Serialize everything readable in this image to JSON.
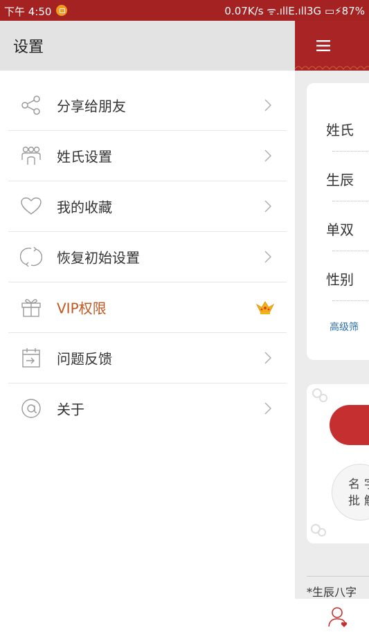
{
  "status_bar": {
    "time": "下午 4:50",
    "right": "0.07K/s ᯤ.ıllE.ıll3G ▭⚡87%"
  },
  "drawer": {
    "title": "设置",
    "items": [
      {
        "label": "分享给朋友",
        "icon": "share-icon",
        "trailing": "chevron"
      },
      {
        "label": "姓氏设置",
        "icon": "people-icon",
        "trailing": "chevron"
      },
      {
        "label": "我的收藏",
        "icon": "heart-icon",
        "trailing": "chevron"
      },
      {
        "label": "恢复初始设置",
        "icon": "refresh-icon",
        "trailing": "chevron"
      },
      {
        "label": "VIP权限",
        "icon": "gift-icon",
        "trailing": "crown"
      },
      {
        "label": "问题反馈",
        "icon": "feedback-icon",
        "trailing": "chevron"
      },
      {
        "label": "关于",
        "icon": "at-icon",
        "trailing": "chevron"
      }
    ],
    "vip_color": "#c0571e"
  },
  "background_app": {
    "fields": [
      "姓氏",
      "生辰",
      "单双",
      "性别"
    ],
    "advanced_link": "高级筛",
    "circle_text_1": "名字",
    "circle_text_2": "批解",
    "footnote": "*生辰八字",
    "accent": "#a92424"
  }
}
